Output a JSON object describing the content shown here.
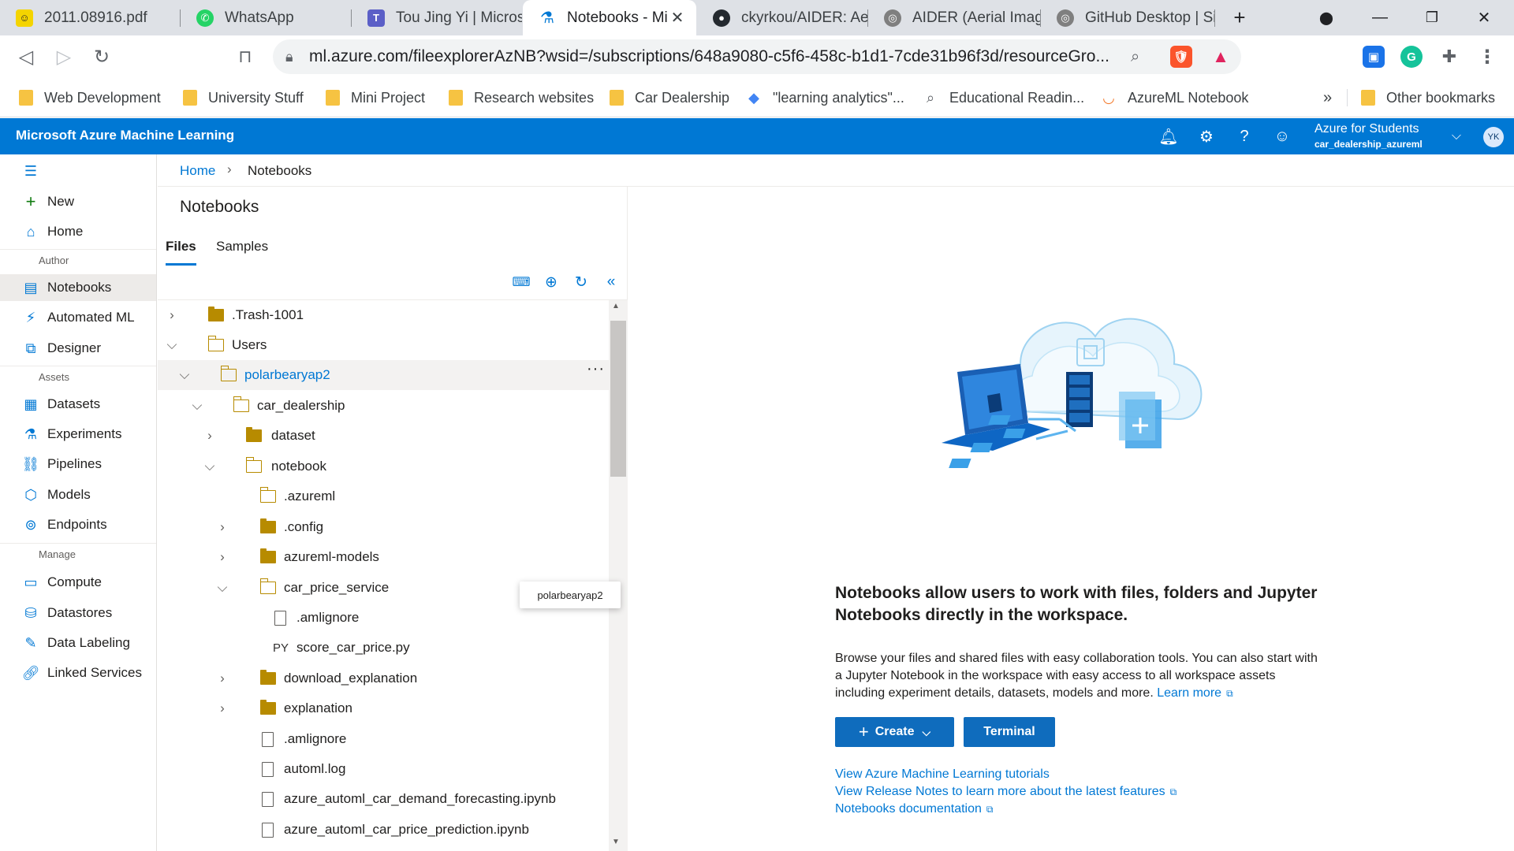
{
  "browser": {
    "tabs": [
      {
        "title": "2011.08916.pdf",
        "icon": "smiley-icon"
      },
      {
        "title": "WhatsApp",
        "icon": "whatsapp-icon"
      },
      {
        "title": "Tou Jing Yi | Microso",
        "icon": "teams-icon"
      },
      {
        "title": "Notebooks - Mic",
        "icon": "azureml-icon",
        "active": true
      },
      {
        "title": "ckyrkou/AIDER: Aeria",
        "icon": "github-icon"
      },
      {
        "title": "AIDER (Aerial Image",
        "icon": "globe-icon"
      },
      {
        "title": "GitHub Desktop | Sin",
        "icon": "globe-icon"
      }
    ],
    "url": "ml.azure.com/fileexplorerAzNB?wsid=/subscriptions/648a9080-c5f6-458c-b1d1-7cde31b96f3d/resourceGro...",
    "bookmarks": [
      {
        "label": "Web Development",
        "type": "folder"
      },
      {
        "label": "University Stuff",
        "type": "folder"
      },
      {
        "label": "Mini Project",
        "type": "folder"
      },
      {
        "label": "Research websites",
        "type": "folder"
      },
      {
        "label": "Car Dealership",
        "type": "folder"
      },
      {
        "label": "\"learning analytics\"...",
        "type": "link"
      },
      {
        "label": "Educational Readin...",
        "type": "link"
      },
      {
        "label": "AzureML Notebook",
        "type": "link"
      }
    ],
    "bookmarks_more": "»",
    "other_bookmarks": "Other bookmarks"
  },
  "header": {
    "brand": "Microsoft Azure Machine Learning",
    "account_name": "Azure for Students",
    "workspace": "car_dealership_azureml",
    "avatar_initials": "YK",
    "brand_color": "#0078d4"
  },
  "nav": {
    "items": {
      "new": "New",
      "home": "Home",
      "notebooks": "Notebooks",
      "automl": "Automated ML",
      "designer": "Designer",
      "datasets": "Datasets",
      "experiments": "Experiments",
      "pipelines": "Pipelines",
      "models": "Models",
      "endpoints": "Endpoints",
      "compute": "Compute",
      "datastores": "Datastores",
      "labeling": "Data Labeling",
      "linked": "Linked Services"
    },
    "groups": {
      "author": "Author",
      "assets": "Assets",
      "manage": "Manage"
    }
  },
  "breadcrumb": {
    "home": "Home",
    "current": "Notebooks"
  },
  "files": {
    "title": "Notebooks",
    "tabs": {
      "files": "Files",
      "samples": "Samples"
    },
    "tree": {
      "trash": ".Trash-1001",
      "users": "Users",
      "user": "polarbearyap2",
      "project": "car_dealership",
      "dataset": "dataset",
      "notebook": "notebook",
      "azureml": ".azureml",
      "config": ".config",
      "models": "azureml-models",
      "service": "car_price_service",
      "amlignore1": ".amlignore",
      "score": "score_car_price.py",
      "download": "download_explanation",
      "explanation": "explanation",
      "amlignore2": ".amlignore",
      "automl_log": "automl.log",
      "demand_nb": "azure_automl_car_demand_forecasting.ipynb",
      "price_nb": "azure_automl_car_price_prediction.ipynb"
    },
    "py_badge": "PY",
    "tooltip": "polarbearyap2"
  },
  "main": {
    "headline": "Notebooks allow users to work with files, folders and Jupyter Notebooks directly in the workspace.",
    "paragraph": "Browse your files and shared files with easy collaboration tools. You can also start with a Jupyter Notebook in the workspace with easy access to all workspace assets including experiment details, datasets, models and more.",
    "learn_more": "Learn more",
    "create_label": "Create",
    "terminal_label": "Terminal",
    "links": {
      "tutorials": "View Azure Machine Learning tutorials",
      "release_notes": "View Release Notes to learn more about the latest features",
      "docs": "Notebooks documentation"
    }
  }
}
